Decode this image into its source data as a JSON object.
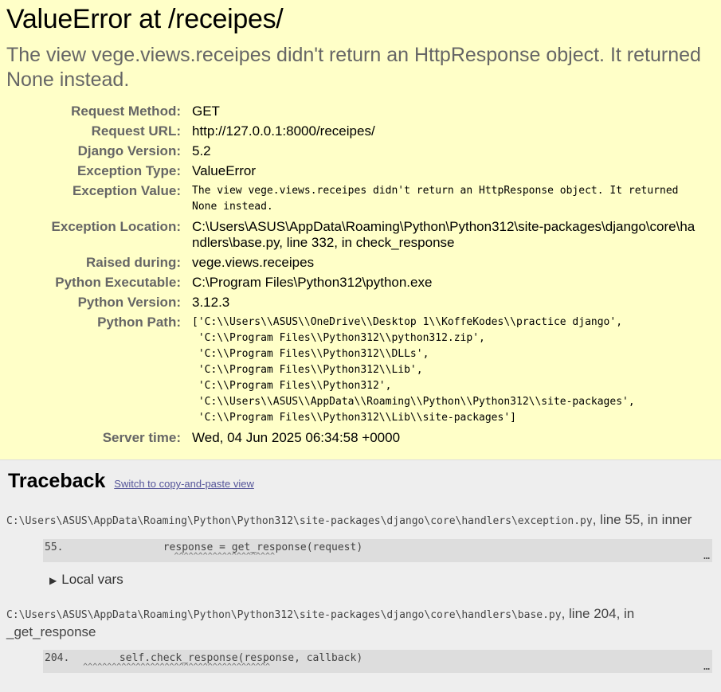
{
  "summary": {
    "title": "ValueError at /receipes/",
    "message": "The view vege.views.receipes didn't return an HttpResponse object. It returned None instead.",
    "rows": [
      {
        "label": "Request Method:",
        "value": "GET"
      },
      {
        "label": "Request URL:",
        "value": "http://127.0.0.1:8000/receipes/"
      },
      {
        "label": "Django Version:",
        "value": "5.2"
      },
      {
        "label": "Exception Type:",
        "value": "ValueError"
      },
      {
        "label": "Exception Value:",
        "value": "The view vege.views.receipes didn't return an HttpResponse object. It returned None instead."
      },
      {
        "label": "Exception Location:",
        "value": "C:\\Users\\ASUS\\AppData\\Roaming\\Python\\Python312\\site-packages\\django\\core\\handlers\\base.py, line 332, in check_response"
      },
      {
        "label": "Raised during:",
        "value": "vege.views.receipes"
      },
      {
        "label": "Python Executable:",
        "value": "C:\\Program Files\\Python312\\python.exe"
      },
      {
        "label": "Python Version:",
        "value": "3.12.3"
      },
      {
        "label": "Python Path:",
        "value": "['C:\\\\Users\\\\ASUS\\\\OneDrive\\\\Desktop 1\\\\KoffeKodes\\\\practice django',\n 'C:\\\\Program Files\\\\Python312\\\\python312.zip',\n 'C:\\\\Program Files\\\\Python312\\\\DLLs',\n 'C:\\\\Program Files\\\\Python312\\\\Lib',\n 'C:\\\\Program Files\\\\Python312',\n 'C:\\\\Users\\\\ASUS\\\\AppData\\\\Roaming\\\\Python\\\\Python312\\\\site-packages',\n 'C:\\\\Program Files\\\\Python312\\\\Lib\\\\site-packages']"
      },
      {
        "label": "Server time:",
        "value": "Wed, 04 Jun 2025 06:34:58 +0000"
      }
    ]
  },
  "traceback": {
    "title": "Traceback",
    "switch_link": "Switch to copy-and-paste view",
    "frames": [
      {
        "path": "C:\\Users\\ASUS\\AppData\\Roaming\\Python\\Python312\\site-packages\\django\\core\\handlers\\exception.py",
        "location": ", line 55, in inner",
        "lineno": "55.",
        "code": "                response = get_response(request)",
        "carets": "                           ^^^^^^^^^^^^^^^^^^^^^",
        "ellipsis": "…",
        "local_vars": "Local vars"
      },
      {
        "path": "C:\\Users\\ASUS\\AppData\\Roaming\\Python\\Python312\\site-packages\\django\\core\\handlers\\base.py",
        "location": ", line 204, in _get_response",
        "lineno": "204.",
        "code": "        self.check_response(response, callback)",
        "carets": "        ^^^^^^^^^^^^^^^^^^^^^^^^^^^^^^^^^^^^^^^",
        "ellipsis": "…"
      }
    ]
  }
}
